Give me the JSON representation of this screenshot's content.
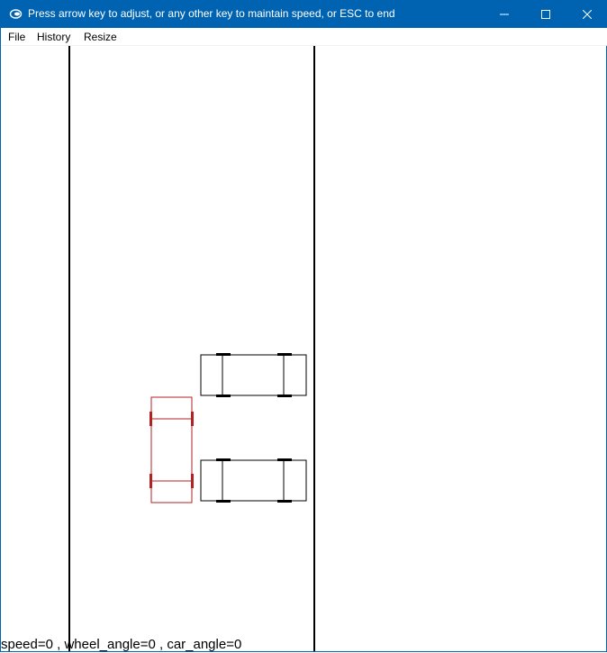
{
  "window": {
    "title": "Press arrow key to adjust, or any other key to maintain speed, or ESC to end",
    "icon": "app-icon",
    "controls": [
      "minimize-icon",
      "maximize-icon",
      "close-icon"
    ],
    "accent_color": "#0063b1"
  },
  "menu": {
    "file": "File",
    "history": "History",
    "resize": "Resize"
  },
  "scene": {
    "player_car_color": "#b22222",
    "parked_car_color": "#000000"
  },
  "status": {
    "text": "speed=0 , wheel_angle=0 , car_angle=0"
  }
}
